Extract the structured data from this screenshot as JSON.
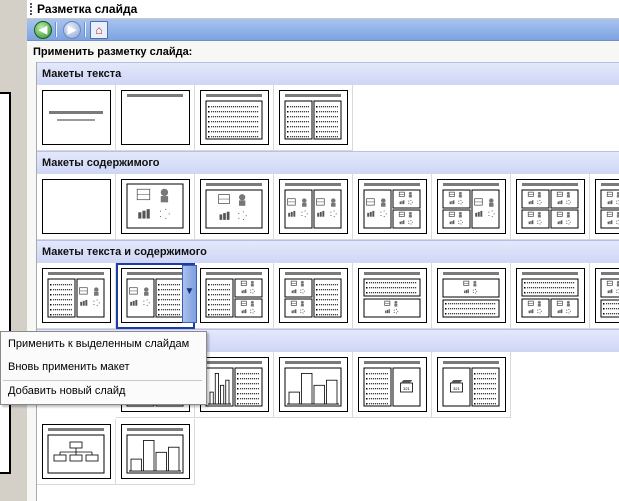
{
  "pane": {
    "title": "Разметка слайда",
    "apply_label": "Применить разметку слайда:",
    "nav": {
      "back_icon": "back-arrow-icon",
      "forward_icon": "forward-arrow-icon",
      "home_icon": "home-icon"
    }
  },
  "sections": [
    {
      "key": "text",
      "title": "Макеты текста",
      "layouts": [
        "title-slide",
        "title-only",
        "title-bulleted-list",
        "title-two-column-text"
      ]
    },
    {
      "key": "content",
      "title": "Макеты содержимого",
      "layouts": [
        "blank",
        "content",
        "title-content",
        "title-two-content",
        "title-content-two-content",
        "title-two-content-content",
        "title-four-content",
        "title-four-content-wide"
      ]
    },
    {
      "key": "text_content",
      "title": "Макеты текста и содержимого",
      "layouts": [
        "title-text-content",
        "title-content-text",
        "title-text-two-content",
        "title-two-content-text",
        "title-text-over-content",
        "title-content-over-text",
        "title-text-two-content-wide",
        "title-two-content-over-text"
      ],
      "selected_index": 1
    },
    {
      "key": "other",
      "title": "",
      "layouts": [
        "title-text-chart",
        "title-chart-text",
        "title-chart",
        "title-text-media",
        "title-media-text",
        "title-org-chart",
        "title-chart-only"
      ]
    }
  ],
  "context_menu": {
    "items": [
      {
        "label": "Применить к выделенным слайдам"
      },
      {
        "label": "Вновь применить макет"
      },
      {
        "label": "Добавить новый слайд"
      }
    ]
  },
  "colors": {
    "section_header": "#cfd6f6",
    "nav_bar": "#7ea3e2",
    "selection": "#1d3ea0"
  }
}
